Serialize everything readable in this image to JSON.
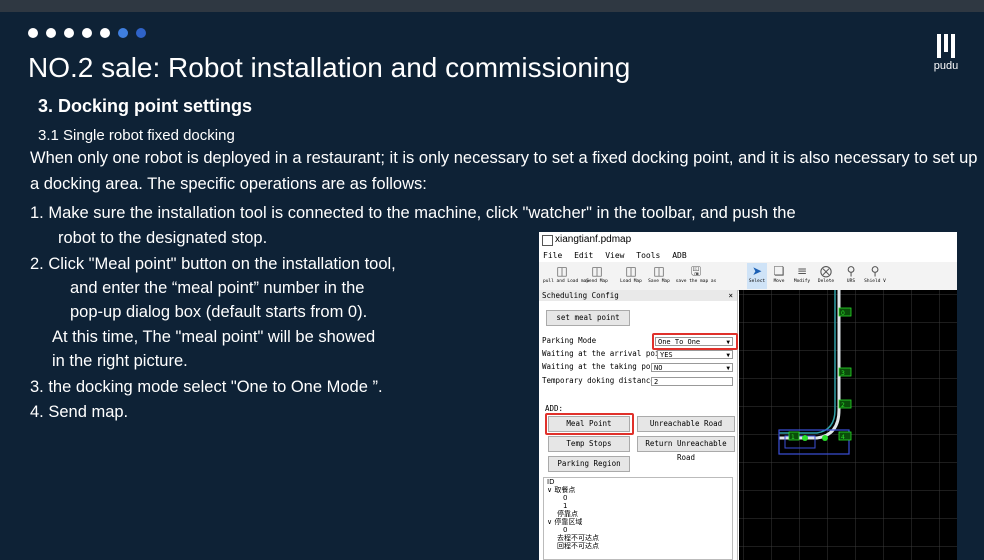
{
  "dots": {
    "colors": [
      "#ffffff",
      "#ffffff",
      "#ffffff",
      "#ffffff",
      "#ffffff",
      "#3f7fe0",
      "#2f63c8"
    ]
  },
  "slide": {
    "title": "NO.2 sale: Robot installation and commissioning",
    "logo_text": "pudu",
    "section": "3. Docking point settings",
    "subsection": "3.1  Single robot fixed docking",
    "paragraph": "When only one robot is deployed in a restaurant; it is only necessary to set a fixed docking point, and it is also necessary to set up a docking area. The specific operations are as follows:",
    "step1_a": "1.  Make sure the installation tool is connected to the machine, click \"watcher\" in the toolbar, and push the",
    "step1_b": "robot to the designated stop.",
    "step2_a": "2.  Click  \"Meal point\" button on the installation tool,",
    "step2_b": "and enter the  “meal point”  number in the",
    "step2_c": "pop-up dialog box (default starts from 0).",
    "step2_d": "At this time, The \"meal point\" will be showed",
    "step2_e": "in the right picture.",
    "step3": "3. the docking mode select \"One to One Mode  ”.",
    "step4": "4. Send map."
  },
  "app": {
    "window_title": "xiangtianf.pdmap",
    "menu": [
      "File",
      "Edit",
      "View",
      "Tools",
      "ADB"
    ],
    "toolbar_left": [
      {
        "icon": "pull-load-icon",
        "label": "pull and Load map"
      },
      {
        "icon": "send-map-icon",
        "label": "Send Map"
      },
      {
        "icon": "load-map-icon",
        "label": "Load Map"
      },
      {
        "icon": "save-map-icon",
        "label": "Save Map"
      },
      {
        "icon": "save-as-icon",
        "label": "save the map as"
      }
    ],
    "toolbar_right": [
      {
        "icon": "select-icon",
        "label": "Select"
      },
      {
        "icon": "move-icon",
        "label": "Move"
      },
      {
        "icon": "modify-icon",
        "label": "Modify"
      },
      {
        "icon": "delete-icon",
        "label": "Delete"
      },
      {
        "icon": "urs-icon",
        "label": "URS"
      },
      {
        "icon": "shield-icon",
        "label": "Shield V"
      }
    ],
    "panel_title": "Scheduling Config",
    "panel_close": "×",
    "set_meal_point": "set meal point",
    "parking_mode_label": "Parking Mode",
    "parking_mode_value": "One To One",
    "waiting_arrival_label": "Waiting at the arrival point",
    "waiting_arrival_value": "YES",
    "waiting_taking_label": "Waiting at the taking pose",
    "waiting_taking_value": "NO",
    "temp_dist_label": "Temporary doking distance",
    "temp_dist_value": "2",
    "add_label": "ADD:",
    "btn_meal_point": "Meal Point",
    "btn_unreachable": "Unreachable Road",
    "btn_temp_stops": "Temp Stops",
    "btn_return_unreachable": "Return Unreachable Road",
    "btn_parking_region": "Parking Region",
    "tree": [
      "ID",
      "∨ 取餐点",
      "0",
      "1",
      "停靠点",
      "∨ 停靠区域",
      "0",
      "去程不可达点",
      "回程不可达点"
    ],
    "map_labels": [
      "0",
      "3",
      "2",
      "1",
      "4"
    ]
  }
}
